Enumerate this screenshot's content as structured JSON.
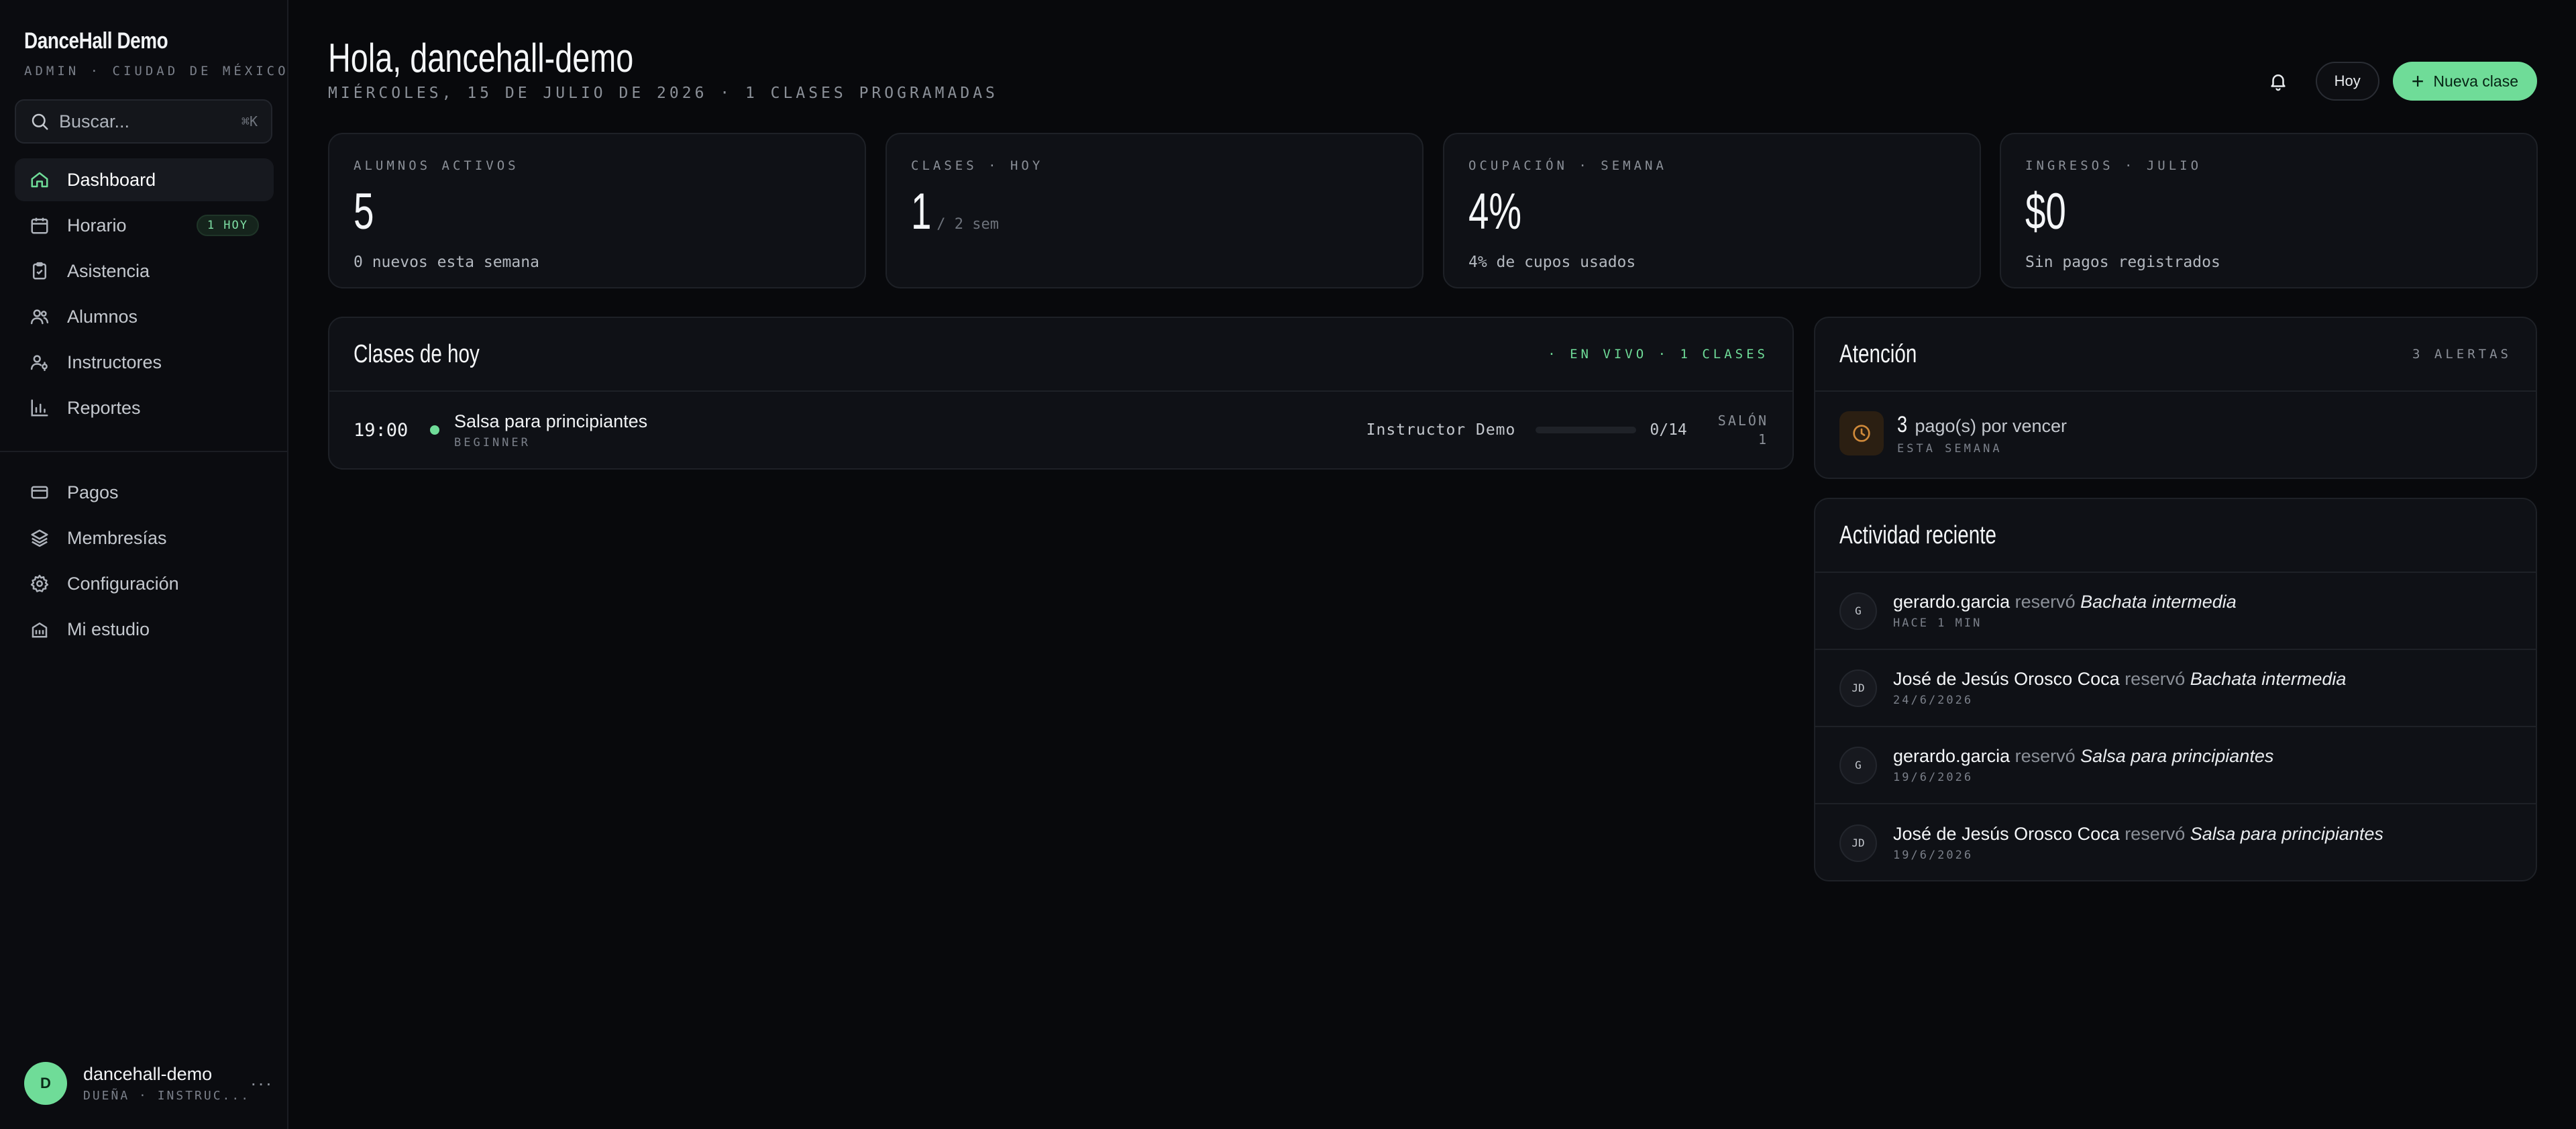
{
  "brand": {
    "name": "DanceHall Demo",
    "subtitle": "ADMIN · CIUDAD DE MÉXICO"
  },
  "search": {
    "placeholder": "Buscar...",
    "shortcut": "⌘K"
  },
  "nav": {
    "primary": [
      {
        "label": "Dashboard",
        "icon": "home-icon",
        "active": true
      },
      {
        "label": "Horario",
        "icon": "calendar-icon",
        "badge": "1 HOY"
      },
      {
        "label": "Asistencia",
        "icon": "clipboard-check-icon"
      },
      {
        "label": "Alumnos",
        "icon": "users-icon"
      },
      {
        "label": "Instructores",
        "icon": "user-cog-icon"
      },
      {
        "label": "Reportes",
        "icon": "bar-chart-icon"
      }
    ],
    "secondary": [
      {
        "label": "Pagos",
        "icon": "credit-card-icon"
      },
      {
        "label": "Membresías",
        "icon": "layers-icon"
      },
      {
        "label": "Configuración",
        "icon": "gear-icon"
      },
      {
        "label": "Mi estudio",
        "icon": "building-icon"
      }
    ]
  },
  "user": {
    "initial": "D",
    "name": "dancehall-demo",
    "role": "DUEÑA · INSTRUC..."
  },
  "header": {
    "greeting": "Hola, dancehall-demo",
    "subtitle": "MIÉRCOLES, 15 DE JULIO DE 2026 · 1 CLASES PROGRAMADAS",
    "today_label": "Hoy",
    "new_class_label": "Nueva clase"
  },
  "stats": [
    {
      "label": "ALUMNOS ACTIVOS",
      "value": "5",
      "suffix": "",
      "foot": "0 nuevos esta semana"
    },
    {
      "label": "CLASES · HOY",
      "value": "1",
      "suffix": "/ 2 sem",
      "foot": ""
    },
    {
      "label": "OCUPACIÓN · SEMANA",
      "value": "4%",
      "suffix": "",
      "foot": "4% de cupos usados"
    },
    {
      "label": "INGRESOS · JULIO",
      "value": "$0",
      "suffix": "",
      "foot": "Sin pagos registrados"
    }
  ],
  "classes_today": {
    "title": "Clases de hoy",
    "meta": "· EN VIVO · 1 CLASES",
    "items": [
      {
        "time": "19:00",
        "name": "Salsa para principiantes",
        "level": "BEGINNER",
        "instructor": "Instructor Demo",
        "capacity_text": "0/14",
        "capacity_fraction": 0,
        "room_line1": "SALÓN",
        "room_line2": "1"
      }
    ]
  },
  "attention": {
    "title": "Atención",
    "meta": "3 ALERTAS",
    "items": [
      {
        "count": "3",
        "text": "pago(s) por vencer",
        "sub": "ESTA SEMANA",
        "icon": "clock-icon"
      }
    ]
  },
  "activity": {
    "title": "Actividad reciente",
    "items": [
      {
        "initials": "G",
        "user": "gerardo.garcia",
        "verb": "reservó",
        "class": "Bachata intermedia",
        "time": "HACE 1 MIN"
      },
      {
        "initials": "JD",
        "user": "José de Jesús Orosco Coca",
        "verb": "reservó",
        "class": "Bachata intermedia",
        "time": "24/6/2026"
      },
      {
        "initials": "G",
        "user": "gerardo.garcia",
        "verb": "reservó",
        "class": "Salsa para principiantes",
        "time": "19/6/2026"
      },
      {
        "initials": "JD",
        "user": "José de Jesús Orosco Coca",
        "verb": "reservó",
        "class": "Salsa para principiantes",
        "time": "19/6/2026"
      }
    ]
  },
  "colors": {
    "accent": "#6fdc98",
    "background": "#08090c",
    "panel": "#0f1116",
    "warning": "#d08a3a"
  }
}
